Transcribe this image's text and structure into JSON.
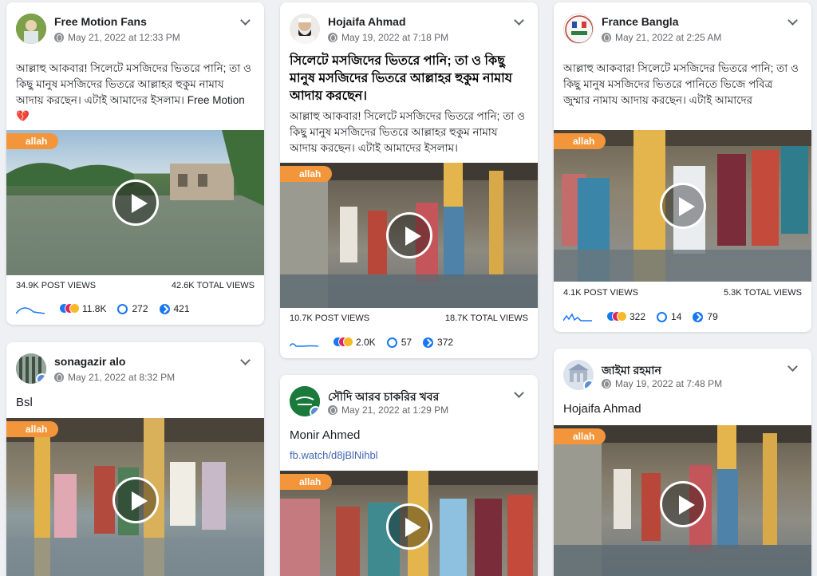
{
  "video_tag": "allah",
  "col1": {
    "card1": {
      "name": "Free Motion Fans",
      "date": "May 21, 2022 at 12:33 PM",
      "text": "আল্লাহু আকবার! সিলেটে মসজিদের ভিতরে পানি; তা ও কিছু মানুষ মসজিদের ভিতরে আল্লাহর হুকুম নামায আদায় করছেন। এটাই আমাদের ইসলাম। Free Motion 💔",
      "post_views": "34.9K POST VIEWS",
      "total_views": "42.6K TOTAL VIEWS",
      "reactions": "11.8K",
      "comments": "272",
      "shares": "421"
    },
    "card2": {
      "name": "sonagazir alo",
      "date": "May 21, 2022 at 8:32 PM",
      "text": "Bsl"
    }
  },
  "col2": {
    "card1": {
      "name": "Hojaifa Ahmad",
      "date": "May 19, 2022 at 7:18 PM",
      "headline": "সিলেটে মসজিদের ভিতরে পানি; তা ও কিছু মানুষ মসজিদের ভিতরে আল্লাহর হুকুম নামায আদায় করছেন।",
      "text": "আল্লাহু আকবার! সিলেটে মসজিদের ভিতরে পানি; তা ও কিছু মানুষ মসজিদের ভিতরে আল্লাহর হুকুম নামায আদায় করছেন। এটাই আমাদের ইসলাম।",
      "post_views": "10.7K POST VIEWS",
      "total_views": "18.7K TOTAL VIEWS",
      "reactions": "2.0K",
      "comments": "57",
      "shares": "372"
    },
    "card2": {
      "name": "সৌদি আরব চাকরির খবর",
      "date": "May 21, 2022 at 1:29 PM",
      "text": "Monir Ahmed",
      "link": "fb.watch/d8jBlNihbl"
    }
  },
  "col3": {
    "card1": {
      "name": "France Bangla",
      "date": "May 21, 2022 at 2:25 AM",
      "text": "আল্লাহু আকবার! সিলেটে মসজিদের ভিতরে পানি; তা ও কিছু মানুষ মসজিদের ভিতরে পানিতে ভিজে পবিত্র জুম্মার নামায আদায় করছেন। এটাই আমাদের",
      "post_views": "4.1K POST VIEWS",
      "total_views": "5.3K TOTAL VIEWS",
      "reactions": "322",
      "comments": "14",
      "shares": "79"
    },
    "card2": {
      "name": "জাইমা রহমান",
      "date": "May 19, 2022 at 7:48 PM",
      "text": "Hojaifa Ahmad"
    }
  }
}
